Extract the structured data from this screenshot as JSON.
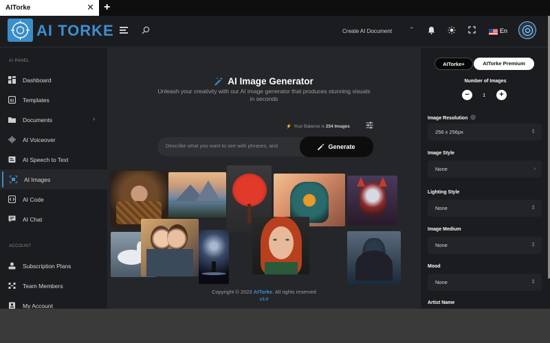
{
  "browser": {
    "tab_title": "AITorke",
    "tab_close": "✕",
    "new_tab": "+"
  },
  "topbar": {
    "logo_text": "AI TORKE",
    "create_document": "Create AI Document",
    "language": "En"
  },
  "sidebar": {
    "section_ai_panel": "AI PANEL",
    "section_account": "ACCOUNT",
    "items": [
      {
        "label": "Dashboard",
        "icon": "dashboard-icon"
      },
      {
        "label": "Templates",
        "icon": "templates-icon"
      },
      {
        "label": "Documents",
        "icon": "folder-icon",
        "has_submenu": true
      },
      {
        "label": "AI Voiceover",
        "icon": "waveform-icon"
      },
      {
        "label": "AI Speech to Text",
        "icon": "speech-icon"
      },
      {
        "label": "AI Images",
        "icon": "image-icon",
        "active": true
      },
      {
        "label": "AI Code",
        "icon": "code-icon"
      },
      {
        "label": "AI Chat",
        "icon": "chat-icon"
      }
    ],
    "account_items": [
      {
        "label": "Subscription Plans",
        "icon": "subscription-icon"
      },
      {
        "label": "Team Members",
        "icon": "team-icon"
      },
      {
        "label": "My Account",
        "icon": "account-icon"
      }
    ]
  },
  "main": {
    "title": "AI Image Generator",
    "subtitle": "Unleash your creativity with our AI image generator that produces stunning visuals in seconds",
    "balance_prefix": "Your Balance is",
    "balance_value": "254 Images",
    "prompt_placeholder": "Describe what you want to see with phrases, and",
    "generate_label": "Generate",
    "copyright_prefix": "Copyright © 2023",
    "copyright_brand": "AITorke",
    "copyright_suffix": ". All rights reserved",
    "version": "v3.0",
    "gallery": [
      {
        "name": "baby-in-basket-image"
      },
      {
        "name": "mountain-lake-image"
      },
      {
        "name": "red-tree-image"
      },
      {
        "name": "ornate-lantern-image"
      },
      {
        "name": "robot-fox-image"
      },
      {
        "name": "unicorn-image"
      },
      {
        "name": "couple-kiss-image"
      },
      {
        "name": "cosmic-figure-image"
      },
      {
        "name": "redhead-portrait-image"
      },
      {
        "name": "dark-knight-image"
      }
    ]
  },
  "panel": {
    "plan_free": "AITorke+",
    "plan_premium": "AITorke Premium",
    "number_of_images_label": "Number of Images",
    "stepper_minus": "−",
    "stepper_plus": "+",
    "number_of_images": "1",
    "fields": [
      {
        "label": "Image Resolution",
        "value": "256 x 256px",
        "arrow": "⇕",
        "info": true
      },
      {
        "label": "Image Style",
        "value": "None",
        "arrow": "›"
      },
      {
        "label": "Lighting Style",
        "value": "None",
        "arrow": "⇕"
      },
      {
        "label": "Image Medium",
        "value": "None",
        "arrow": "⇕"
      },
      {
        "label": "Mood",
        "value": "None",
        "arrow": "⇕"
      },
      {
        "label": "Artist Name",
        "value": "",
        "arrow": ""
      }
    ]
  },
  "colors": {
    "accent": "#3d8fd0",
    "background": "#1f2023",
    "panel": "#1b1c1f"
  }
}
